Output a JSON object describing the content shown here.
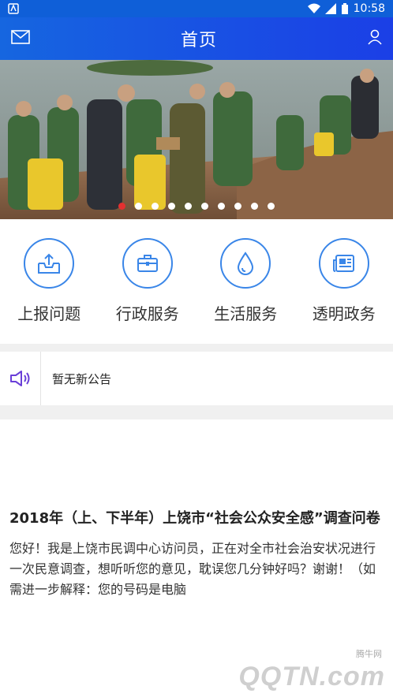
{
  "status_bar": {
    "time": "10:58"
  },
  "app_bar": {
    "title": "首页",
    "left_icon": "mail-icon",
    "right_icon": "user-icon"
  },
  "banner": {
    "slide_count": 10,
    "active_index": 0
  },
  "services": [
    {
      "label": "上报问题",
      "icon": "upload-tray-icon"
    },
    {
      "label": "行政服务",
      "icon": "briefcase-icon"
    },
    {
      "label": "生活服务",
      "icon": "water-drop-icon"
    },
    {
      "label": "透明政务",
      "icon": "newspaper-icon"
    }
  ],
  "notice": {
    "icon": "speaker-icon",
    "text": "暂无新公告"
  },
  "article": {
    "title": "2018年（上、下半年）上饶市“社会公众安全感”调查问卷",
    "body": "您好！我是上饶市民调中心访问员，正在对全市社会治安状况进行一次民意调查，想听听您的意见，耽误您几分钟好吗？谢谢！（如需进一步解释：您的号码是电脑"
  },
  "watermark": {
    "text": "QQTN.com",
    "small": "腾牛网"
  },
  "colors": {
    "primary": "#1666e0",
    "icon_blue": "#3a86e8",
    "dot_active": "#e53030",
    "accent_purple": "#6a3fd8"
  }
}
